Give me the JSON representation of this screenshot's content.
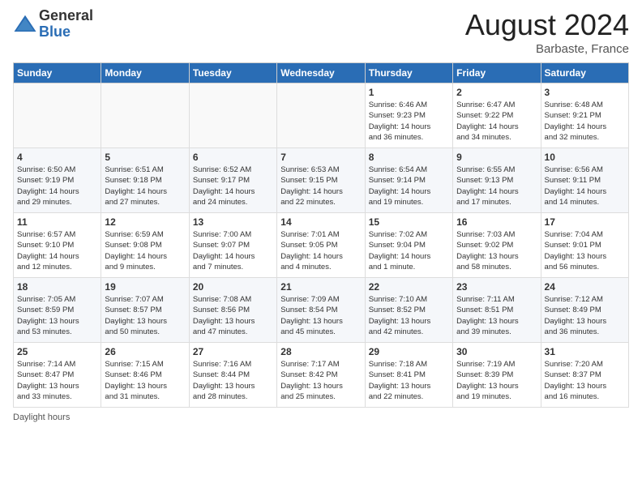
{
  "header": {
    "logo_general": "General",
    "logo_blue": "Blue",
    "month_title": "August 2024",
    "location": "Barbaste, France"
  },
  "footer": {
    "daylight_label": "Daylight hours"
  },
  "weekdays": [
    "Sunday",
    "Monday",
    "Tuesday",
    "Wednesday",
    "Thursday",
    "Friday",
    "Saturday"
  ],
  "weeks": [
    [
      {
        "day": "",
        "info": ""
      },
      {
        "day": "",
        "info": ""
      },
      {
        "day": "",
        "info": ""
      },
      {
        "day": "",
        "info": ""
      },
      {
        "day": "1",
        "info": "Sunrise: 6:46 AM\nSunset: 9:23 PM\nDaylight: 14 hours\nand 36 minutes."
      },
      {
        "day": "2",
        "info": "Sunrise: 6:47 AM\nSunset: 9:22 PM\nDaylight: 14 hours\nand 34 minutes."
      },
      {
        "day": "3",
        "info": "Sunrise: 6:48 AM\nSunset: 9:21 PM\nDaylight: 14 hours\nand 32 minutes."
      }
    ],
    [
      {
        "day": "4",
        "info": "Sunrise: 6:50 AM\nSunset: 9:19 PM\nDaylight: 14 hours\nand 29 minutes."
      },
      {
        "day": "5",
        "info": "Sunrise: 6:51 AM\nSunset: 9:18 PM\nDaylight: 14 hours\nand 27 minutes."
      },
      {
        "day": "6",
        "info": "Sunrise: 6:52 AM\nSunset: 9:17 PM\nDaylight: 14 hours\nand 24 minutes."
      },
      {
        "day": "7",
        "info": "Sunrise: 6:53 AM\nSunset: 9:15 PM\nDaylight: 14 hours\nand 22 minutes."
      },
      {
        "day": "8",
        "info": "Sunrise: 6:54 AM\nSunset: 9:14 PM\nDaylight: 14 hours\nand 19 minutes."
      },
      {
        "day": "9",
        "info": "Sunrise: 6:55 AM\nSunset: 9:13 PM\nDaylight: 14 hours\nand 17 minutes."
      },
      {
        "day": "10",
        "info": "Sunrise: 6:56 AM\nSunset: 9:11 PM\nDaylight: 14 hours\nand 14 minutes."
      }
    ],
    [
      {
        "day": "11",
        "info": "Sunrise: 6:57 AM\nSunset: 9:10 PM\nDaylight: 14 hours\nand 12 minutes."
      },
      {
        "day": "12",
        "info": "Sunrise: 6:59 AM\nSunset: 9:08 PM\nDaylight: 14 hours\nand 9 minutes."
      },
      {
        "day": "13",
        "info": "Sunrise: 7:00 AM\nSunset: 9:07 PM\nDaylight: 14 hours\nand 7 minutes."
      },
      {
        "day": "14",
        "info": "Sunrise: 7:01 AM\nSunset: 9:05 PM\nDaylight: 14 hours\nand 4 minutes."
      },
      {
        "day": "15",
        "info": "Sunrise: 7:02 AM\nSunset: 9:04 PM\nDaylight: 14 hours\nand 1 minute."
      },
      {
        "day": "16",
        "info": "Sunrise: 7:03 AM\nSunset: 9:02 PM\nDaylight: 13 hours\nand 58 minutes."
      },
      {
        "day": "17",
        "info": "Sunrise: 7:04 AM\nSunset: 9:01 PM\nDaylight: 13 hours\nand 56 minutes."
      }
    ],
    [
      {
        "day": "18",
        "info": "Sunrise: 7:05 AM\nSunset: 8:59 PM\nDaylight: 13 hours\nand 53 minutes."
      },
      {
        "day": "19",
        "info": "Sunrise: 7:07 AM\nSunset: 8:57 PM\nDaylight: 13 hours\nand 50 minutes."
      },
      {
        "day": "20",
        "info": "Sunrise: 7:08 AM\nSunset: 8:56 PM\nDaylight: 13 hours\nand 47 minutes."
      },
      {
        "day": "21",
        "info": "Sunrise: 7:09 AM\nSunset: 8:54 PM\nDaylight: 13 hours\nand 45 minutes."
      },
      {
        "day": "22",
        "info": "Sunrise: 7:10 AM\nSunset: 8:52 PM\nDaylight: 13 hours\nand 42 minutes."
      },
      {
        "day": "23",
        "info": "Sunrise: 7:11 AM\nSunset: 8:51 PM\nDaylight: 13 hours\nand 39 minutes."
      },
      {
        "day": "24",
        "info": "Sunrise: 7:12 AM\nSunset: 8:49 PM\nDaylight: 13 hours\nand 36 minutes."
      }
    ],
    [
      {
        "day": "25",
        "info": "Sunrise: 7:14 AM\nSunset: 8:47 PM\nDaylight: 13 hours\nand 33 minutes."
      },
      {
        "day": "26",
        "info": "Sunrise: 7:15 AM\nSunset: 8:46 PM\nDaylight: 13 hours\nand 31 minutes."
      },
      {
        "day": "27",
        "info": "Sunrise: 7:16 AM\nSunset: 8:44 PM\nDaylight: 13 hours\nand 28 minutes."
      },
      {
        "day": "28",
        "info": "Sunrise: 7:17 AM\nSunset: 8:42 PM\nDaylight: 13 hours\nand 25 minutes."
      },
      {
        "day": "29",
        "info": "Sunrise: 7:18 AM\nSunset: 8:41 PM\nDaylight: 13 hours\nand 22 minutes."
      },
      {
        "day": "30",
        "info": "Sunrise: 7:19 AM\nSunset: 8:39 PM\nDaylight: 13 hours\nand 19 minutes."
      },
      {
        "day": "31",
        "info": "Sunrise: 7:20 AM\nSunset: 8:37 PM\nDaylight: 13 hours\nand 16 minutes."
      }
    ]
  ]
}
